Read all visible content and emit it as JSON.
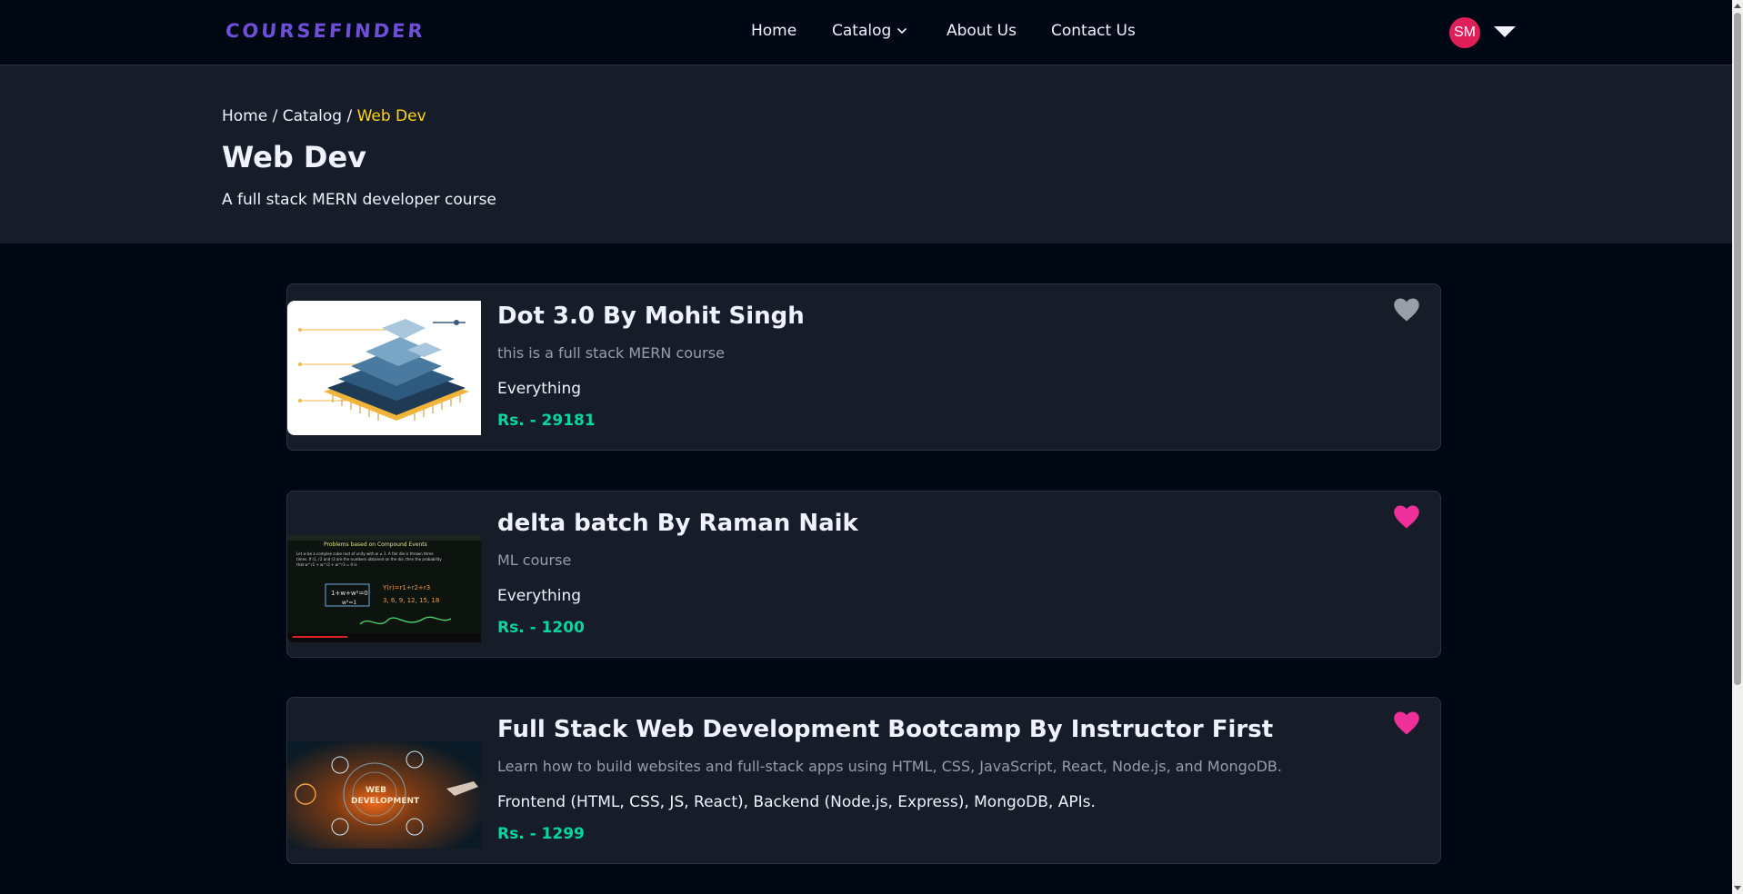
{
  "navbar": {
    "logo": "COURSEFINDER",
    "links": {
      "home": "Home",
      "catalog": "Catalog",
      "about": "About Us",
      "contact": "Contact Us"
    },
    "avatar_initials": "SM"
  },
  "hero": {
    "breadcrumb": {
      "home": "Home",
      "sep1": " / ",
      "catalog": "Catalog",
      "sep2": " / ",
      "current": "Web Dev"
    },
    "title": "Web Dev",
    "description": "A full stack MERN developer course"
  },
  "courses": [
    {
      "title": "Dot 3.0 By Mohit Singh",
      "description": "this is a full stack MERN course",
      "tag": "Everything",
      "price": "Rs. - 29181",
      "favorited": false,
      "thumb_icon": "chip-layers-image"
    },
    {
      "title": "delta batch By Raman Naik",
      "description": "ML course",
      "tag": "Everything",
      "price": "Rs. - 1200",
      "favorited": true,
      "thumb_icon": "blackboard-lecture-image"
    },
    {
      "title": "Full Stack Web Development Bootcamp By Instructor First",
      "description": "Learn how to build websites and full-stack apps using HTML, CSS, JavaScript, React, Node.js, and MongoDB.",
      "tag": "Frontend (HTML, CSS, JS, React), Backend (Node.js, Express), MongoDB, APIs.",
      "price": "Rs. - 1299",
      "favorited": true,
      "thumb_icon": "web-development-image"
    }
  ],
  "colors": {
    "background": "#000814",
    "hero": "#161d29",
    "accent_yellow": "#ffd60a",
    "price_green": "#06d6a0",
    "heart_active": "#ef2f9a",
    "heart_inactive": "#9a9ea8",
    "avatar": "#e01e5a"
  }
}
